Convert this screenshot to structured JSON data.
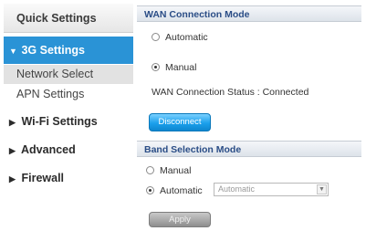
{
  "sidebar": {
    "quick_settings": "Quick Settings",
    "g3_settings": "3G Settings",
    "network_select": "Network Select",
    "apn_settings": "APN Settings",
    "wifi_settings": "Wi-Fi Settings",
    "advanced": "Advanced",
    "firewall": "Firewall",
    "expanded_glyph": "▼",
    "collapsed_glyph": "▶",
    "accent_color": "#2a93d6"
  },
  "wan": {
    "header": "WAN Connection Mode",
    "automatic_label": "Automatic",
    "manual_label": "Manual",
    "selected": "manual",
    "status_text": "WAN Connection Status : Connected",
    "disconnect_label": "Disconnect"
  },
  "band": {
    "header": "Band Selection Mode",
    "manual_label": "Manual",
    "automatic_label": "Automatic",
    "selected": "automatic",
    "select_value": "Automatic",
    "apply_label": "Apply"
  },
  "icons": {
    "radio": "radio-button-icon",
    "dropdown": "chevron-down-icon",
    "expanded": "triangle-down-icon",
    "collapsed": "triangle-right-icon"
  }
}
